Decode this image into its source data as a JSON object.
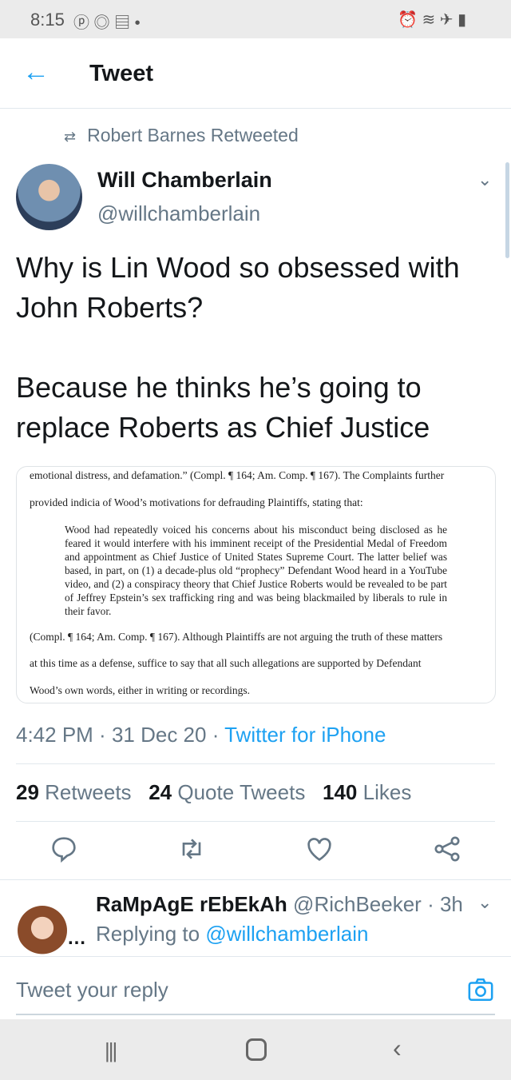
{
  "status_bar": {
    "time": "8:15"
  },
  "header": {
    "title": "Tweet"
  },
  "retweet": {
    "label": "Robert Barnes Retweeted"
  },
  "author": {
    "name": "Will Chamberlain",
    "handle": "@willchamberlain"
  },
  "tweet": {
    "line1": "Why is Lin Wood so obsessed with John Roberts?",
    "line2": "Because he thinks he’s going to replace Roberts as Chief Justice"
  },
  "image_text": {
    "p1": "emotional distress, and defamation.” (Compl. ¶ 164; Am. Comp. ¶ 167).  The Complaints further",
    "p2": "provided indicia of Wood’s motivations for defrauding Plaintiffs, stating that:",
    "quote": "Wood had repeatedly voiced his concerns about his misconduct being disclosed as he feared it would interfere with his imminent receipt of the Presidential Medal of Freedom and appointment as Chief Justice of United States Supreme Court. The latter belief was based, in part, on (1) a decade-plus old “prophecy” Defendant Wood heard in a YouTube video, and (2) a conspiracy theory that Chief Justice Roberts would be revealed to be part of Jeffrey Epstein’s sex trafficking ring and was being blackmailed by liberals to rule in their favor.",
    "p3": "(Compl. ¶ 164; Am. Comp. ¶ 167).  Although Plaintiffs are not arguing the truth of these matters",
    "p4": "at this time as a defense, suffice to say that all such allegations are supported by Defendant",
    "p5": "Wood’s own words, either in writing or recordings."
  },
  "meta": {
    "time": "4:42 PM",
    "date": "31 Dec 20",
    "sep": " · ",
    "source": "Twitter for iPhone"
  },
  "stats": {
    "retweets": "29",
    "retweets_label": "Retweets",
    "quotes": "24",
    "quotes_label": "Quote Tweets",
    "likes": "140",
    "likes_label": "Likes"
  },
  "reply": {
    "name": "RaMpAgE rEbEkAh",
    "handle": "@RichBeeker",
    "time": "· 3h",
    "replying_label": "Replying to",
    "replying_to": "@willchamberlain"
  },
  "compose": {
    "placeholder": "Tweet your reply"
  }
}
